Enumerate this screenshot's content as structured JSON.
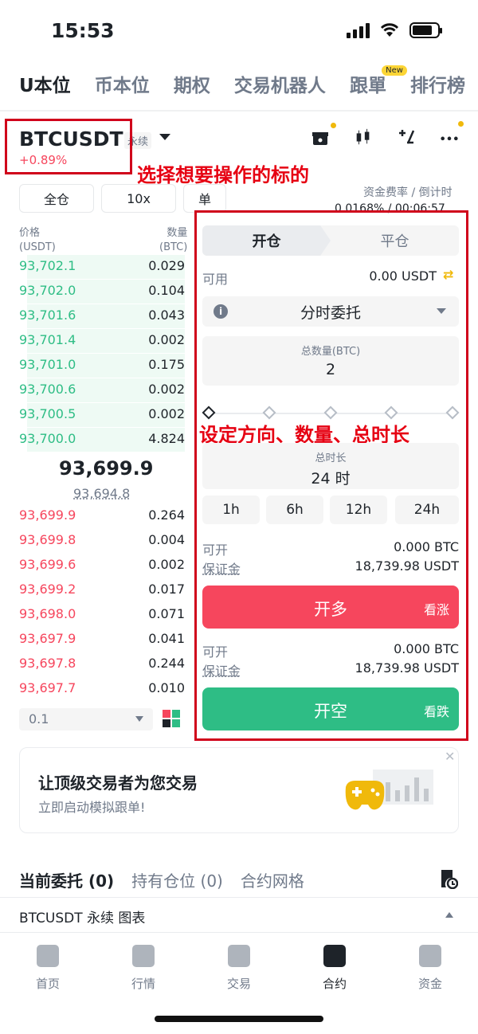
{
  "status": {
    "time": "15:53"
  },
  "tabs": [
    {
      "label": "U本位",
      "active": true
    },
    {
      "label": "币本位",
      "active": false
    },
    {
      "label": "期权",
      "active": false
    },
    {
      "label": "交易机器人",
      "active": false
    },
    {
      "label": "跟單",
      "active": false,
      "badge": "New"
    },
    {
      "label": "排行榜",
      "active": false
    }
  ],
  "symbol": {
    "name": "BTCUSDT",
    "type": "永续",
    "change": "+0.89%"
  },
  "annotations": {
    "select": "选择想要操作的标的",
    "setup": "设定方向、数量、总时长"
  },
  "selectors": {
    "margin_mode": "全仓",
    "leverage": "10x",
    "position_mode": "单"
  },
  "funding": {
    "label": "资金费率 / 倒计时",
    "value": "0.0168% / 00:06:57"
  },
  "orderbook": {
    "price_header": "价格",
    "price_unit": "(USDT)",
    "qty_header": "数量",
    "qty_unit": "(BTC)",
    "asks": [
      {
        "price": "93,702.1",
        "qty": "0.029",
        "depth": 0.95
      },
      {
        "price": "93,702.0",
        "qty": "0.104",
        "depth": 0.95
      },
      {
        "price": "93,701.6",
        "qty": "0.043",
        "depth": 0.95
      },
      {
        "price": "93,701.4",
        "qty": "0.002",
        "depth": 0.95
      },
      {
        "price": "93,701.0",
        "qty": "0.175",
        "depth": 0.95
      },
      {
        "price": "93,700.6",
        "qty": "0.002",
        "depth": 0.95
      },
      {
        "price": "93,700.5",
        "qty": "0.002",
        "depth": 0.95
      },
      {
        "price": "93,700.0",
        "qty": "4.824",
        "depth": 0.95
      }
    ],
    "mid_price": "93,699.9",
    "mark_price": "93,694.8",
    "bids": [
      {
        "price": "93,699.9",
        "qty": "0.264"
      },
      {
        "price": "93,699.8",
        "qty": "0.004"
      },
      {
        "price": "93,699.6",
        "qty": "0.002"
      },
      {
        "price": "93,699.2",
        "qty": "0.017"
      },
      {
        "price": "93,698.0",
        "qty": "0.071"
      },
      {
        "price": "93,697.9",
        "qty": "0.041"
      },
      {
        "price": "93,697.8",
        "qty": "0.244"
      },
      {
        "price": "93,697.7",
        "qty": "0.010"
      }
    ],
    "precision": "0.1"
  },
  "order": {
    "open_label": "开仓",
    "close_label": "平仓",
    "available_label": "可用",
    "available_value": "0.00 USDT",
    "order_type": "分时委托",
    "total_qty_label": "总数量(BTC)",
    "total_qty_value": "2",
    "duration_label": "总时长",
    "duration_value": "24 时",
    "duration_options": [
      "1h",
      "6h",
      "12h",
      "24h"
    ],
    "long": {
      "can_open_label": "可开",
      "can_open_value": "0.000 BTC",
      "margin_label": "保证金",
      "margin_value": "18,739.98 USDT",
      "button": "开多",
      "hint": "看涨"
    },
    "short": {
      "can_open_label": "可开",
      "can_open_value": "0.000 BTC",
      "margin_label": "保证金",
      "margin_value": "18,739.98 USDT",
      "button": "开空",
      "hint": "看跌"
    }
  },
  "banner": {
    "title": "让顶级交易者为您交易",
    "subtitle": "立即启动模拟跟单!"
  },
  "bottom_tabs": [
    {
      "label": "当前委托 (0)",
      "active": true
    },
    {
      "label": "持有仓位 (0)",
      "active": false
    },
    {
      "label": "合约网格",
      "active": false
    }
  ],
  "pair_row": "BTCUSDT 永续  图表",
  "nav": [
    {
      "label": "首页",
      "active": false
    },
    {
      "label": "行情",
      "active": false
    },
    {
      "label": "交易",
      "active": false
    },
    {
      "label": "合约",
      "active": true
    },
    {
      "label": "资金",
      "active": false
    }
  ],
  "colors": {
    "red": "#f6465d",
    "green": "#2ebd85",
    "annotation": "#e60012",
    "accent": "#f0b90b"
  }
}
